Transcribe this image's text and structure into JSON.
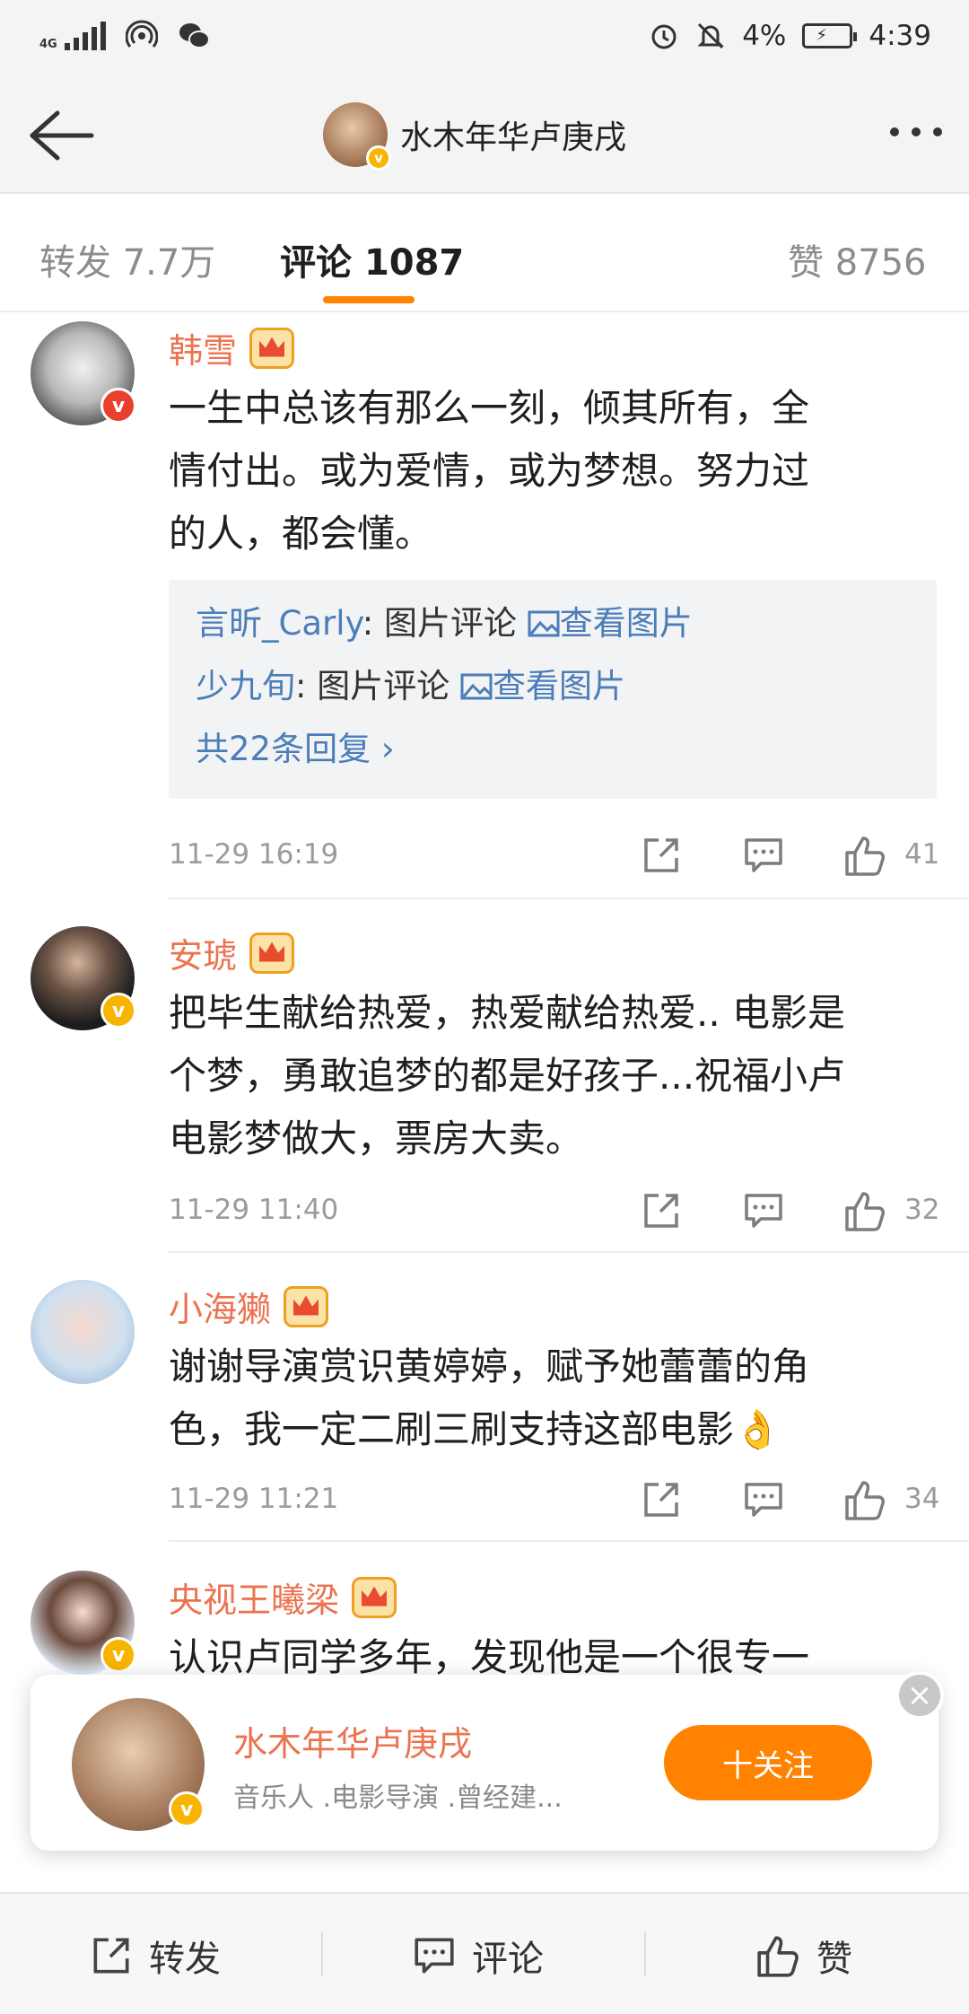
{
  "status_bar": {
    "network": "4G",
    "battery": "4%",
    "time": "4:39"
  },
  "header": {
    "title": "水木年华卢庚戌"
  },
  "tabs": {
    "repost": "转发 7.7万",
    "comments_label": "评论",
    "comments_count": "1087",
    "likes": "赞 8756"
  },
  "comments": [
    {
      "name": "韩雪",
      "text_lines": [
        "一生中总该有那么一刻，倾其所有，全",
        "情付出。或为爱情，或为梦想。努力过",
        "的人，都会懂。"
      ],
      "replies": [
        {
          "user": "言昕_Carly",
          "text": ": 图片评论 ",
          "link": "查看图片"
        },
        {
          "user": "少九旬",
          "text": ": 图片评论 ",
          "link": "查看图片"
        }
      ],
      "reply_more": "共22条回复 ›",
      "time": "11-29 16:19",
      "likes": "41"
    },
    {
      "name": "安琥",
      "text_lines": [
        "把毕生献给热爱，热爱献给热爱.. 电影是",
        "个梦，勇敢追梦的都是好孩子...祝福小卢",
        "电影梦做大，票房大卖。"
      ],
      "time": "11-29 11:40",
      "likes": "32"
    },
    {
      "name": "小海獭",
      "text_lines": [
        "谢谢导演赏识黄婷婷，赋予她蕾蕾的角",
        "色，我一定二刷三刷支持这部电影👌"
      ],
      "time": "11-29 11:21",
      "likes": "34"
    },
    {
      "name": "央视王曦梁",
      "text_lines": [
        "认识卢同学多年，发现他是一个很专一"
      ]
    }
  ],
  "follow_card": {
    "name": "水木年华卢庚戌",
    "desc": "音乐人 .电影导演 .曾经建...",
    "follow_button": "十关注",
    "close": "×"
  },
  "bottom_bar": {
    "repost": "转发",
    "comment": "评论",
    "like": "赞"
  }
}
